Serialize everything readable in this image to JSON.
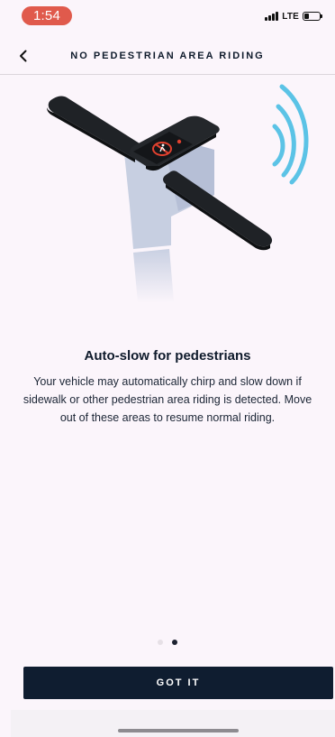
{
  "status_bar": {
    "time": "1:54",
    "network": "LTE",
    "battery_level": 0.3
  },
  "header": {
    "back_icon": "chevron-left-icon",
    "title": "NO PEDESTRIAN AREA RIDING"
  },
  "illustration": {
    "icon": "scooter-handlebar-pedestrian-warning",
    "colors": {
      "handlebar": "#1f2226",
      "stem": "#c7cfe0",
      "waves": "#5bc3e6",
      "warning": "#e0412f"
    }
  },
  "content": {
    "title": "Auto-slow for pedestrians",
    "body": "Your vehicle may automatically chirp and slow down if sidewalk or other pedestrian area riding is detected. Move out of these areas to resume normal riding."
  },
  "pagination": {
    "total": 2,
    "active_index": 1
  },
  "actions": {
    "got_it_label": "GOT IT"
  },
  "colors": {
    "background": "#fbf5fb",
    "primary_button": "#0f1d30",
    "time_pill": "#e05a4c"
  }
}
